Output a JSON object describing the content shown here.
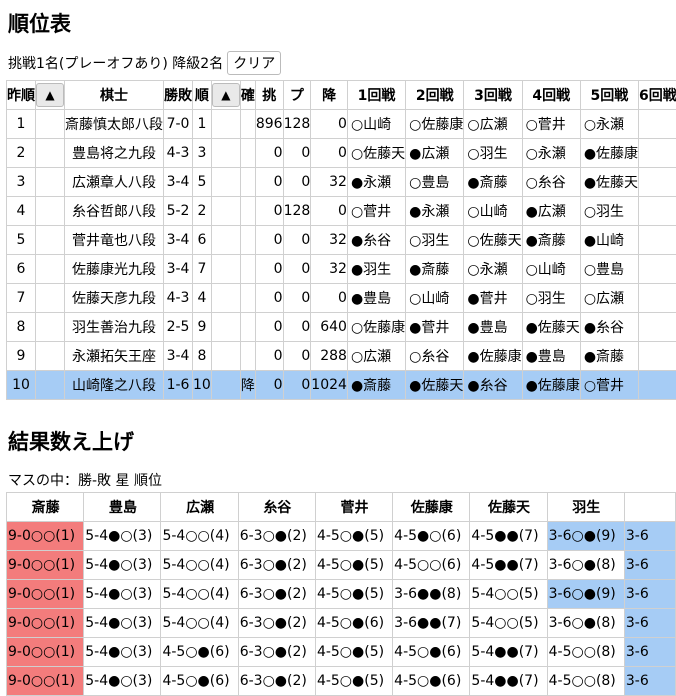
{
  "standings_title": "順位表",
  "controls": {
    "text": "挑戦1名(プレーオフあり) 降級2名",
    "clear_label": "クリア"
  },
  "standings": {
    "headers": [
      "昨順",
      "▲",
      "棋士",
      "勝敗",
      "順",
      "▲",
      "確",
      "挑",
      "プ",
      "降",
      "1回戦",
      "2回戦",
      "3回戦",
      "4回戦",
      "5回戦",
      "6回戦"
    ],
    "rows": [
      {
        "prev": "1",
        "name": "斎藤慎太郎八段",
        "record": "7-0",
        "rank": "1",
        "conf": "",
        "chal": "896",
        "play": "128",
        "rel": "0",
        "r": [
          "○山崎",
          "○佐藤康",
          "○広瀬",
          "○菅井",
          "○永瀬",
          ""
        ]
      },
      {
        "prev": "2",
        "name": "豊島将之九段",
        "record": "4-3",
        "rank": "3",
        "conf": "",
        "chal": "0",
        "play": "0",
        "rel": "0",
        "r": [
          "○佐藤天",
          "●広瀬",
          "○羽生",
          "○永瀬",
          "●佐藤康",
          ""
        ]
      },
      {
        "prev": "3",
        "name": "広瀬章人八段",
        "record": "3-4",
        "rank": "5",
        "conf": "",
        "chal": "0",
        "play": "0",
        "rel": "32",
        "r": [
          "●永瀬",
          "○豊島",
          "●斎藤",
          "○糸谷",
          "●佐藤天",
          ""
        ]
      },
      {
        "prev": "4",
        "name": "糸谷哲郎八段",
        "record": "5-2",
        "rank": "2",
        "conf": "",
        "chal": "0",
        "play": "128",
        "rel": "0",
        "r": [
          "○菅井",
          "●永瀬",
          "○山崎",
          "●広瀬",
          "○羽生",
          ""
        ]
      },
      {
        "prev": "5",
        "name": "菅井竜也八段",
        "record": "3-4",
        "rank": "6",
        "conf": "",
        "chal": "0",
        "play": "0",
        "rel": "32",
        "r": [
          "●糸谷",
          "○羽生",
          "○佐藤天",
          "●斎藤",
          "●山崎",
          ""
        ]
      },
      {
        "prev": "6",
        "name": "佐藤康光九段",
        "record": "3-4",
        "rank": "7",
        "conf": "",
        "chal": "0",
        "play": "0",
        "rel": "32",
        "r": [
          "●羽生",
          "●斎藤",
          "○永瀬",
          "○山崎",
          "○豊島",
          ""
        ]
      },
      {
        "prev": "7",
        "name": "佐藤天彦九段",
        "record": "4-3",
        "rank": "4",
        "conf": "",
        "chal": "0",
        "play": "0",
        "rel": "0",
        "r": [
          "●豊島",
          "○山崎",
          "●菅井",
          "○羽生",
          "○広瀬",
          ""
        ]
      },
      {
        "prev": "8",
        "name": "羽生善治九段",
        "record": "2-5",
        "rank": "9",
        "conf": "",
        "chal": "0",
        "play": "0",
        "rel": "640",
        "r": [
          "○佐藤康",
          "●菅井",
          "●豊島",
          "●佐藤天",
          "●糸谷",
          ""
        ]
      },
      {
        "prev": "9",
        "name": "永瀬拓矢王座",
        "record": "3-4",
        "rank": "8",
        "conf": "",
        "chal": "0",
        "play": "0",
        "rel": "288",
        "r": [
          "○広瀬",
          "○糸谷",
          "●佐藤康",
          "●豊島",
          "●斎藤",
          ""
        ]
      },
      {
        "prev": "10",
        "name": "山崎隆之八段",
        "record": "1-6",
        "rank": "10",
        "conf": "降",
        "chal": "0",
        "play": "0",
        "rel": "1024",
        "r": [
          "●斎藤",
          "●佐藤天",
          "●糸谷",
          "●佐藤康",
          "○菅井",
          ""
        ]
      }
    ]
  },
  "results_title": "結果数え上げ",
  "results_subtitle": "マスの中：勝-敗 星 順位",
  "results": {
    "headers": [
      "斎藤",
      "豊島",
      "広瀬",
      "糸谷",
      "菅井",
      "佐藤康",
      "佐藤天",
      "羽生",
      ""
    ],
    "rows": [
      [
        "9-0○○(1)",
        "5-4●○(3)",
        "5-4○○(4)",
        "6-3○●(2)",
        "4-5○●(5)",
        "4-5●○(6)",
        "4-5●●(7)",
        "3-6○●(9)",
        "3-6"
      ],
      [
        "9-0○○(1)",
        "5-4●○(3)",
        "5-4○○(4)",
        "6-3○●(2)",
        "4-5○●(5)",
        "4-5○○(6)",
        "4-5●●(7)",
        "3-6○●(8)",
        "3-6"
      ],
      [
        "9-0○○(1)",
        "5-4●○(3)",
        "5-4○○(4)",
        "6-3○●(2)",
        "4-5○●(5)",
        "3-6●●(8)",
        "5-4○○(5)",
        "3-6○●(9)",
        "3-6"
      ],
      [
        "9-0○○(1)",
        "5-4●○(3)",
        "5-4○○(4)",
        "6-3○●(2)",
        "4-5○●(6)",
        "3-6●●(7)",
        "5-4○○(5)",
        "3-6○●(8)",
        "3-6"
      ],
      [
        "9-0○○(1)",
        "5-4●○(3)",
        "4-5○●(6)",
        "6-3○●(2)",
        "4-5○●(5)",
        "4-5○●(6)",
        "5-4●●(7)",
        "4-5○○(8)",
        "3-6"
      ],
      [
        "9-0○○(1)",
        "5-4●○(3)",
        "4-5○●(6)",
        "6-3○●(2)",
        "4-5○●(5)",
        "4-5○●(6)",
        "5-4●●(7)",
        "4-5○○(8)",
        "3-6"
      ]
    ],
    "cell_colors": [
      [
        "red",
        "",
        "",
        "",
        "",
        "",
        "",
        "blue",
        "blue"
      ],
      [
        "red",
        "",
        "",
        "",
        "",
        "",
        "",
        "",
        "blue"
      ],
      [
        "red",
        "",
        "",
        "",
        "",
        "",
        "",
        "blue",
        "blue"
      ],
      [
        "red",
        "",
        "",
        "",
        "",
        "",
        "",
        "",
        "blue"
      ],
      [
        "red",
        "",
        "",
        "",
        "",
        "",
        "",
        "",
        "blue"
      ],
      [
        "red",
        "",
        "",
        "",
        "",
        "",
        "",
        "",
        "blue"
      ]
    ]
  },
  "colors": {
    "highlight_row": "#a6ccf5",
    "leader_cell": "#f37c7c",
    "relegation_cell": "#a6ccf5"
  },
  "highlighted_row_index": 9
}
